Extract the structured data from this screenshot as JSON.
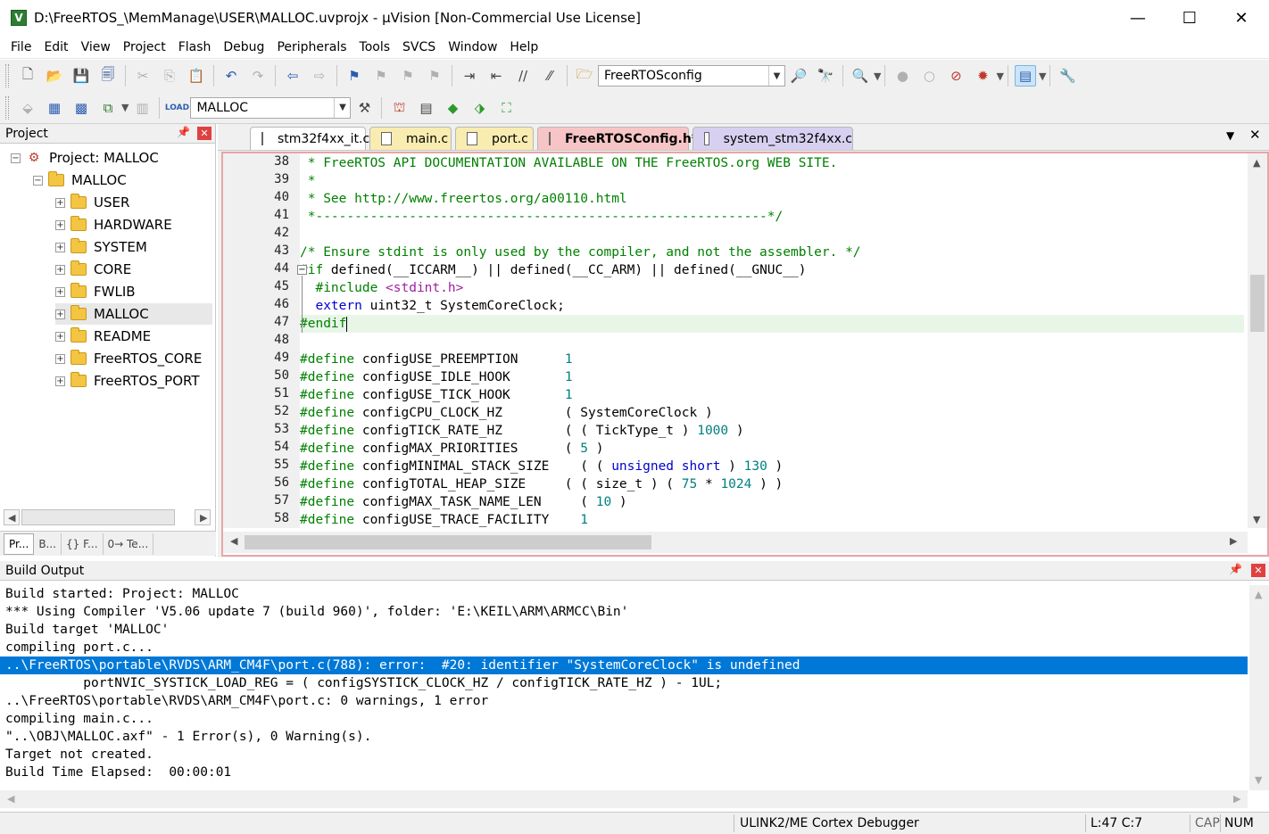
{
  "window": {
    "title": "D:\\FreeRTOS_\\MemManage\\USER\\MALLOC.uvprojx - µVision  [Non-Commercial Use License]",
    "minimize": "—",
    "maximize": "☐",
    "close": "✕"
  },
  "menu": [
    "File",
    "Edit",
    "View",
    "Project",
    "Flash",
    "Debug",
    "Peripherals",
    "Tools",
    "SVCS",
    "Window",
    "Help"
  ],
  "toolbar1": {
    "combo_value": "FreeRTOSconfig"
  },
  "toolbar2": {
    "target_value": "MALLOC"
  },
  "project_panel": {
    "title": "Project",
    "pin": "ꟷ",
    "close": "✕",
    "root": "Project: MALLOC",
    "target": "MALLOC",
    "groups": [
      "USER",
      "HARDWARE",
      "SYSTEM",
      "CORE",
      "FWLIB",
      "MALLOC",
      "README",
      "FreeRTOS_CORE",
      "FreeRTOS_PORT"
    ],
    "selected_group": "MALLOC",
    "tabs": [
      "Pr...",
      "B...",
      "{} F...",
      "0→ Te..."
    ]
  },
  "editor": {
    "tabs": [
      {
        "label": "stm32f4xx_it.c",
        "active": false
      },
      {
        "label": "main.c",
        "active": false
      },
      {
        "label": "port.c",
        "active": false
      },
      {
        "label": "FreeRTOSConfig.h*",
        "active": true
      },
      {
        "label": "system_stm32f4xx.c",
        "active": false
      }
    ],
    "lines": [
      {
        "n": "38",
        "parts": [
          {
            "t": " * FreeRTOS API DOCUMENTATION AVAILABLE ON THE FreeRTOS.org WEB SITE.",
            "c": "com"
          }
        ]
      },
      {
        "n": "39",
        "parts": [
          {
            "t": " *",
            "c": "com"
          }
        ]
      },
      {
        "n": "40",
        "parts": [
          {
            "t": " * See http://www.freertos.org/a00110.html",
            "c": "com"
          }
        ]
      },
      {
        "n": "41",
        "parts": [
          {
            "t": " *----------------------------------------------------------*/",
            "c": "com"
          }
        ]
      },
      {
        "n": "42",
        "parts": [
          {
            "t": "",
            "c": "txt"
          }
        ]
      },
      {
        "n": "43",
        "parts": [
          {
            "t": "/* Ensure stdint is only used by the compiler, and not the assembler. */",
            "c": "com"
          }
        ]
      },
      {
        "n": "44",
        "parts": [
          {
            "t": "#if",
            "c": "pre"
          },
          {
            "t": " defined(__ICCARM__) || defined(__CC_ARM) || defined(__GNUC__)",
            "c": "txt"
          }
        ]
      },
      {
        "n": "45",
        "parts": [
          {
            "t": "  #include ",
            "c": "pre"
          },
          {
            "t": "<stdint.h>",
            "c": "str"
          }
        ]
      },
      {
        "n": "46",
        "parts": [
          {
            "t": "  ",
            "c": "txt"
          },
          {
            "t": "extern",
            "c": "kw"
          },
          {
            "t": " uint32_t SystemCoreClock;",
            "c": "txt"
          }
        ]
      },
      {
        "n": "47",
        "parts": [
          {
            "t": "#endif",
            "c": "pre"
          }
        ]
      },
      {
        "n": "48",
        "parts": [
          {
            "t": "",
            "c": "txt"
          }
        ]
      },
      {
        "n": "49",
        "parts": [
          {
            "t": "#define",
            "c": "pre"
          },
          {
            "t": " configUSE_PREEMPTION      ",
            "c": "txt"
          },
          {
            "t": "1",
            "c": "num"
          }
        ]
      },
      {
        "n": "50",
        "parts": [
          {
            "t": "#define",
            "c": "pre"
          },
          {
            "t": " configUSE_IDLE_HOOK       ",
            "c": "txt"
          },
          {
            "t": "1",
            "c": "num"
          }
        ]
      },
      {
        "n": "51",
        "parts": [
          {
            "t": "#define",
            "c": "pre"
          },
          {
            "t": " configUSE_TICK_HOOK       ",
            "c": "txt"
          },
          {
            "t": "1",
            "c": "num"
          }
        ]
      },
      {
        "n": "52",
        "parts": [
          {
            "t": "#define",
            "c": "pre"
          },
          {
            "t": " configCPU_CLOCK_HZ        ( SystemCoreClock )",
            "c": "txt"
          }
        ]
      },
      {
        "n": "53",
        "parts": [
          {
            "t": "#define",
            "c": "pre"
          },
          {
            "t": " configTICK_RATE_HZ        ( ( TickType_t ) ",
            "c": "txt"
          },
          {
            "t": "1000",
            "c": "num"
          },
          {
            "t": " )",
            "c": "txt"
          }
        ]
      },
      {
        "n": "54",
        "parts": [
          {
            "t": "#define",
            "c": "pre"
          },
          {
            "t": " configMAX_PRIORITIES      ( ",
            "c": "txt"
          },
          {
            "t": "5",
            "c": "num"
          },
          {
            "t": " )",
            "c": "txt"
          }
        ]
      },
      {
        "n": "55",
        "parts": [
          {
            "t": "#define",
            "c": "pre"
          },
          {
            "t": " configMINIMAL_STACK_SIZE    ( ( ",
            "c": "txt"
          },
          {
            "t": "unsigned short",
            "c": "kw"
          },
          {
            "t": " ) ",
            "c": "txt"
          },
          {
            "t": "130",
            "c": "num"
          },
          {
            "t": " )",
            "c": "txt"
          }
        ]
      },
      {
        "n": "56",
        "parts": [
          {
            "t": "#define",
            "c": "pre"
          },
          {
            "t": " configTOTAL_HEAP_SIZE     ( ( size_t ) ( ",
            "c": "txt"
          },
          {
            "t": "75",
            "c": "num"
          },
          {
            "t": " * ",
            "c": "txt"
          },
          {
            "t": "1024",
            "c": "num"
          },
          {
            "t": " ) )",
            "c": "txt"
          }
        ]
      },
      {
        "n": "57",
        "parts": [
          {
            "t": "#define",
            "c": "pre"
          },
          {
            "t": " configMAX_TASK_NAME_LEN     ( ",
            "c": "txt"
          },
          {
            "t": "10",
            "c": "num"
          },
          {
            "t": " )",
            "c": "txt"
          }
        ]
      },
      {
        "n": "58",
        "parts": [
          {
            "t": "#define",
            "c": "pre"
          },
          {
            "t": " configUSE_TRACE_FACILITY    ",
            "c": "txt"
          },
          {
            "t": "1",
            "c": "num"
          }
        ]
      }
    ],
    "current_line": "47"
  },
  "build_output": {
    "title": "Build Output",
    "pin": "ꟷ",
    "close": "✕",
    "lines": [
      "Build started: Project: MALLOC",
      "*** Using Compiler 'V5.06 update 7 (build 960)', folder: 'E:\\KEIL\\ARM\\ARMCC\\Bin'",
      "Build target 'MALLOC'",
      "compiling port.c...",
      "..\\FreeRTOS\\portable\\RVDS\\ARM_CM4F\\port.c(788): error:  #20: identifier \"SystemCoreClock\" is undefined",
      "          portNVIC_SYSTICK_LOAD_REG = ( configSYSTICK_CLOCK_HZ / configTICK_RATE_HZ ) - 1UL;",
      "..\\FreeRTOS\\portable\\RVDS\\ARM_CM4F\\port.c: 0 warnings, 1 error",
      "compiling main.c...",
      "\"..\\OBJ\\MALLOC.axf\" - 1 Error(s), 0 Warning(s).",
      "Target not created.",
      "Build Time Elapsed:  00:00:01"
    ],
    "selected_index": 4
  },
  "statusbar": {
    "debugger": "ULINK2/ME Cortex Debugger",
    "position": "L:47 C:7",
    "cap": "CAP",
    "num": "NUM"
  },
  "colors": {
    "selection": "#0078d7",
    "active_tab": "#f7c5c5",
    "inactive_tab_yellow": "#f8ecb0",
    "inactive_tab_purple": "#d8d0f0",
    "editor_border": "#e8a6a6"
  }
}
